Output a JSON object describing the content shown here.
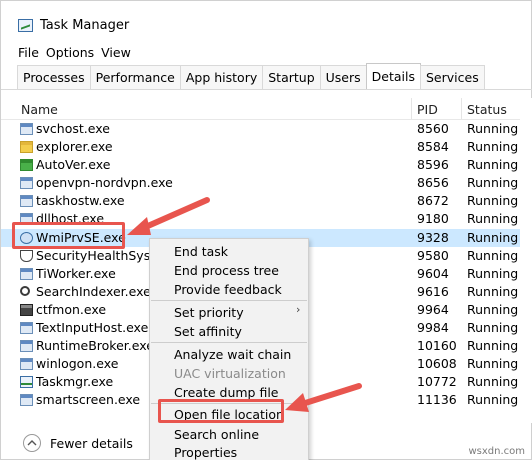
{
  "window": {
    "title": "Task Manager"
  },
  "menu": [
    "File",
    "Options",
    "View"
  ],
  "tabs": [
    "Processes",
    "Performance",
    "App history",
    "Startup",
    "Users",
    "Details",
    "Services"
  ],
  "active_tab": "Details",
  "columns": {
    "name": "Name",
    "pid": "PID",
    "status": "Status"
  },
  "processes": [
    {
      "name": "svchost.exe",
      "pid": "8560",
      "status": "Running",
      "icon": "app-window-icon"
    },
    {
      "name": "explorer.exe",
      "pid": "8584",
      "status": "Running",
      "icon": "folder-icon"
    },
    {
      "name": "AutoVer.exe",
      "pid": "8596",
      "status": "Running",
      "icon": "ver-icon"
    },
    {
      "name": "openvpn-nordvpn.exe",
      "pid": "8656",
      "status": "Running",
      "icon": "app-window-icon"
    },
    {
      "name": "taskhostw.exe",
      "pid": "8672",
      "status": "Running",
      "icon": "app-window-icon"
    },
    {
      "name": "dllhost.exe",
      "pid": "9180",
      "status": "Running",
      "icon": "app-window-icon"
    },
    {
      "name": "WmiPrvSE.exe",
      "pid": "9328",
      "status": "Running",
      "icon": "wmi-icon",
      "selected": true
    },
    {
      "name": "SecurityHealthSystray",
      "pid": "9580",
      "status": "Running",
      "icon": "shield-icon"
    },
    {
      "name": "TiWorker.exe",
      "pid": "9604",
      "status": "Running",
      "icon": "app-window-icon"
    },
    {
      "name": "SearchIndexer.exe",
      "pid": "9616",
      "status": "Running",
      "icon": "search-icon"
    },
    {
      "name": "ctfmon.exe",
      "pid": "9964",
      "status": "Running",
      "icon": "pen-icon"
    },
    {
      "name": "TextInputHost.exe",
      "pid": "9984",
      "status": "Running",
      "icon": "app-window-icon"
    },
    {
      "name": "RuntimeBroker.exe",
      "pid": "10160",
      "status": "Running",
      "icon": "app-window-icon"
    },
    {
      "name": "winlogon.exe",
      "pid": "10608",
      "status": "Running",
      "icon": "app-window-icon"
    },
    {
      "name": "Taskmgr.exe",
      "pid": "10772",
      "status": "Running",
      "icon": "task-manager-icon"
    },
    {
      "name": "smartscreen.exe",
      "pid": "11136",
      "status": "Running",
      "icon": "app-window-icon"
    }
  ],
  "context_menu": [
    {
      "label": "End task"
    },
    {
      "label": "End process tree"
    },
    {
      "label": "Provide feedback"
    },
    {
      "separator": true
    },
    {
      "label": "Set priority",
      "submenu": true
    },
    {
      "label": "Set affinity"
    },
    {
      "separator": true
    },
    {
      "label": "Analyze wait chain"
    },
    {
      "label": "UAC virtualization",
      "disabled": true
    },
    {
      "label": "Create dump file"
    },
    {
      "separator": true
    },
    {
      "label": "Open file location",
      "highlighted": true
    },
    {
      "label": "Search online"
    },
    {
      "label": "Properties"
    }
  ],
  "footer": {
    "fewer_details": "Fewer details"
  },
  "watermark": "wsxdn.com",
  "colors": {
    "annotation_red": "#e8554e",
    "selection": "#cce8ff"
  }
}
